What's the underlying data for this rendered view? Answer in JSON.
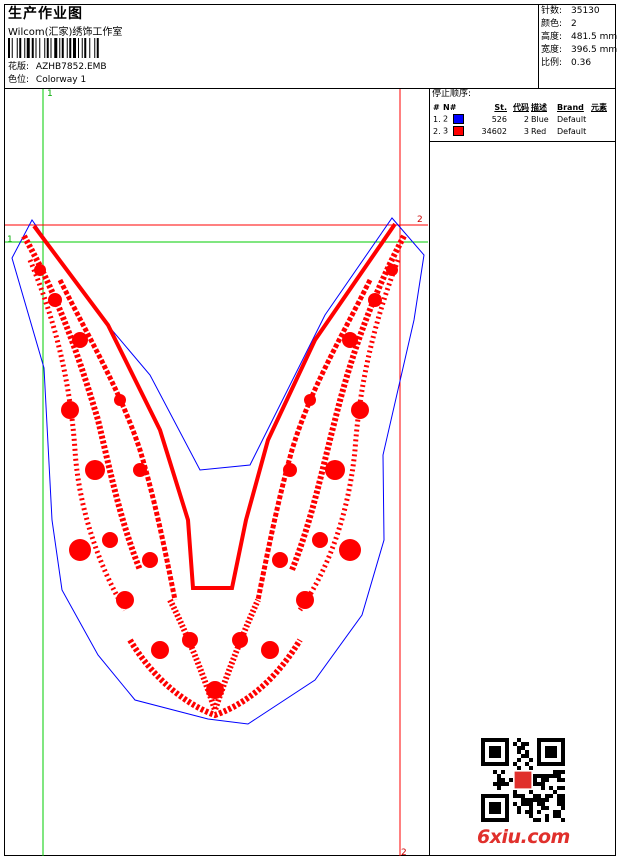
{
  "header": {
    "title": "生产作业图",
    "subtitle": "Wilcom(汇家)绣饰工作室",
    "design_label": "花版:",
    "design_value": "AZHB7852.EMB",
    "colorway_label": "色位:",
    "colorway_value": "Colorway 1"
  },
  "stats": [
    {
      "label": "针数:",
      "value": "35130"
    },
    {
      "label": "颜色:",
      "value": "2"
    },
    {
      "label": "高度:",
      "value": "481.5 mm"
    },
    {
      "label": "宽度:",
      "value": "396.5 mm"
    },
    {
      "label": "比例:",
      "value": "0.36"
    }
  ],
  "sequence": {
    "title": "停止顺序:",
    "headers": [
      "#",
      "N#",
      "St.",
      "代码",
      "描述",
      "Brand",
      "元素"
    ],
    "rows": [
      {
        "index": "1.",
        "needle": "2",
        "color": "#0000ff",
        "stitches": "526",
        "code": "2",
        "description": "Blue",
        "brand": "Default"
      },
      {
        "index": "2.",
        "needle": "3",
        "color": "#ff0000",
        "stitches": "34602",
        "code": "3",
        "description": "Red",
        "brand": "Default"
      }
    ]
  },
  "guides": {
    "green_start": "1",
    "red_end": "2"
  },
  "colors": {
    "stitch_red": "#ff0000",
    "outline_blue": "#0000ff",
    "guide_green": "#00cc00",
    "guide_red": "#ff0000"
  },
  "watermark": {
    "brand": "6xiu",
    "dot": ".",
    "domain": "com"
  }
}
